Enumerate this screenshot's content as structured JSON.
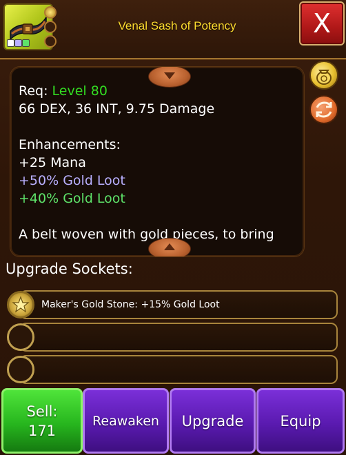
{
  "header": {
    "item_name": "Venal Sash of Potency",
    "close_label": "X"
  },
  "description": {
    "req_label": "Req:",
    "req_value": "Level 80",
    "stats": "66 DEX, 36 INT, 9.75 Damage",
    "enhancements_heading": "Enhancements:",
    "enhancements": [
      {
        "text": "+25 Mana",
        "color": "#ffffff"
      },
      {
        "text": "+50% Gold Loot",
        "color": "#b9b0ff"
      },
      {
        "text": "+40% Gold Loot",
        "color": "#5ee36a"
      }
    ],
    "flavor_text": "A belt woven with gold pieces, to bring"
  },
  "sockets": {
    "heading": "Upgrade Sockets:",
    "slots": [
      {
        "label": "Maker's Gold Stone: +15% Gold Loot",
        "filled": true
      },
      {
        "label": "",
        "filled": false
      },
      {
        "label": "",
        "filled": false
      }
    ]
  },
  "actions": {
    "sell_label": "Sell:",
    "sell_price": "171",
    "reawaken_label": "Reawaken",
    "upgrade_label": "Upgrade",
    "equip_label": "Equip"
  },
  "colors": {
    "title": "#ffdc2e",
    "requirement": "#33dd22",
    "sell_green": "#27b61e",
    "action_purple": "#5a1ab0",
    "close_red": "#b01818"
  },
  "icons": [
    "belt-item-icon",
    "gold-stone-icon",
    "coin-bag-icon",
    "swap-icon",
    "scroll-up-icon",
    "scroll-down-icon"
  ]
}
